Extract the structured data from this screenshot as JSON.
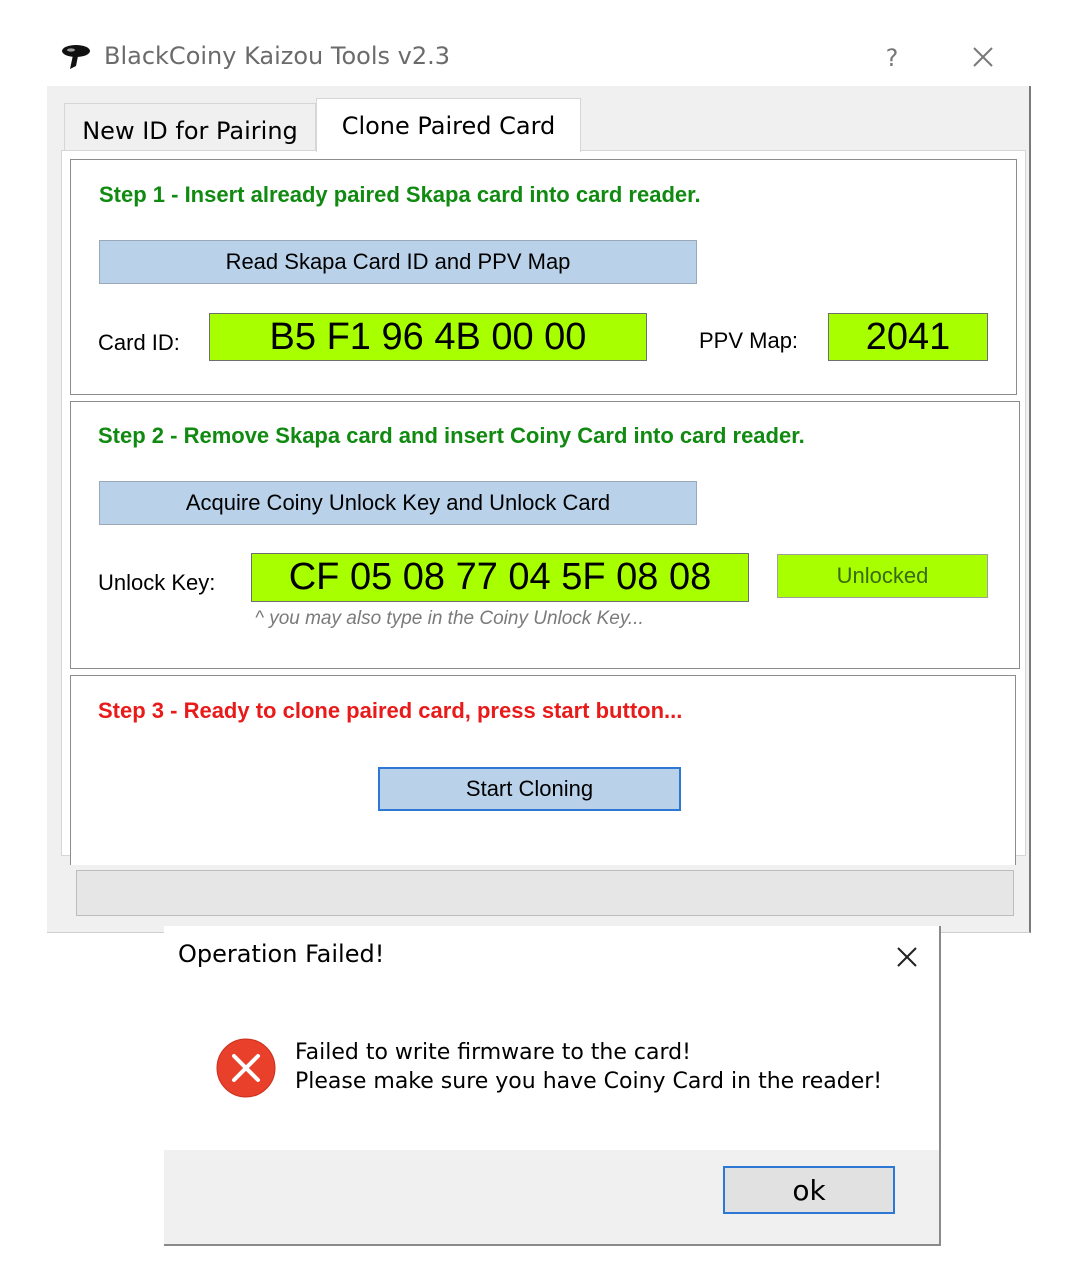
{
  "window": {
    "title": "BlackCoiny Kaizou Tools v2.3",
    "help_label": "?",
    "icons": {
      "app": "blackcoiny-app-icon",
      "close": "close-icon"
    }
  },
  "tabs": [
    {
      "label": "New ID for Pairing",
      "active": false
    },
    {
      "label": "Clone Paired Card",
      "active": true
    }
  ],
  "step1": {
    "title": "Step 1 - Insert already paired Skapa card into card reader.",
    "read_button": "Read Skapa Card ID and PPV Map",
    "card_id_label": "Card ID:",
    "card_id_value": "B5 F1 96 4B 00 00",
    "ppv_label": "PPV Map:",
    "ppv_value": "2041"
  },
  "step2": {
    "title": "Step 2 - Remove Skapa card and insert Coiny Card into card reader.",
    "acquire_button": "Acquire Coiny Unlock Key and Unlock Card",
    "unlock_key_label": "Unlock Key:",
    "unlock_key_value": "CF 05 08 77 04 5F 08 08",
    "status": "Unlocked",
    "hint": "^ you may also type in the Coiny Unlock Key..."
  },
  "step3": {
    "title": "Step 3 - Ready to clone paired card, press start button...",
    "start_button": "Start Cloning"
  },
  "dialog": {
    "title": "Operation Failed!",
    "message_line1": "Failed to write firmware to the card!",
    "message_line2": "Please make sure you have Coiny Card in the reader!",
    "ok_button": "ok",
    "icons": {
      "error": "error-icon",
      "close": "close-icon"
    }
  },
  "colors": {
    "step_ok": "#108a10",
    "step_ready": "#e81a1a",
    "value_box": "#a8ff00",
    "button_blue": "#b9d2ea",
    "focus_border": "#2c78d4",
    "error_red": "#e8402a"
  }
}
